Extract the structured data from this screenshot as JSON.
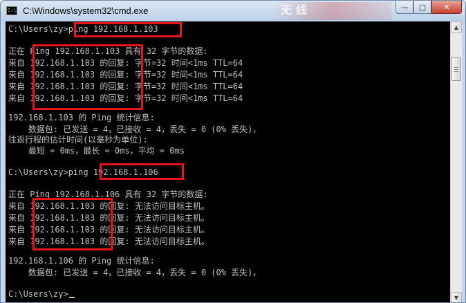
{
  "window": {
    "title": "C:\\Windows\\system32\\cmd.exe",
    "icon_text": "C:\\",
    "watermark": "无线",
    "buttons": {
      "minimize": "—",
      "maximize": "□",
      "close": "✕"
    }
  },
  "console": {
    "lines": [
      "C:\\Users\\zy>ping 192.168.1.103",
      "",
      "正在 Ping 192.168.1.103 具有 32 字节的数据:",
      "来自 192.168.1.103 的回复: 字节=32 时间<1ms TTL=64",
      "来自 192.168.1.103 的回复: 字节=32 时间<1ms TTL=64",
      "来自 192.168.1.103 的回复: 字节=32 时间<1ms TTL=64",
      "来自 192.168.1.103 的回复: 字节=32 时间<1ms TTL=64",
      "",
      "192.168.1.103 的 Ping 统计信息:",
      "    数据包: 已发送 = 4，已接收 = 4，丢失 = 0 (0% 丢失)，",
      "往返行程的估计时间(以毫秒为单位):",
      "    最短 = 0ms，最长 = 0ms，平均 = 0ms",
      "",
      "C:\\Users\\zy>ping 192.168.1.106",
      "",
      "正在 Ping 192.168.1.106 具有 32 字节的数据:",
      "来自 192.168.1.103 的回复: 无法访问目标主机。",
      "来自 192.168.1.103 的回复: 无法访问目标主机。",
      "来自 192.168.1.103 的回复: 无法访问目标主机。",
      "来自 192.168.1.103 的回复: 无法访问目标主机。",
      "",
      "192.168.1.106 的 Ping 统计信息:",
      "    数据包: 已发送 = 4，已接收 = 4，丢失 = 0 (0% 丢失)，",
      "",
      "C:\\Users\\zy>"
    ]
  },
  "colors": {
    "console_background": "#000000",
    "console_text": "#c0c0c0",
    "highlight": "#e8141a"
  }
}
